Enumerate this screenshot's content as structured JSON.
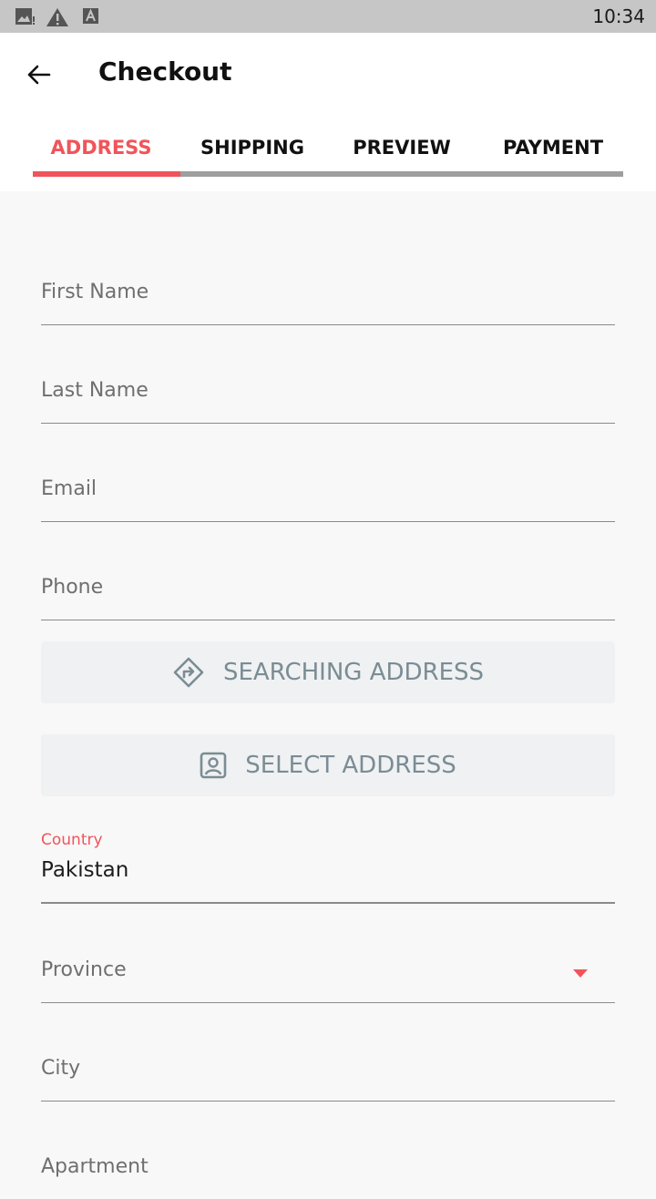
{
  "status_bar": {
    "time": "10:34",
    "icons": [
      "gallery-icon",
      "warning-icon",
      "font-icon"
    ]
  },
  "header": {
    "title": "Checkout",
    "back_icon": "back-arrow-icon"
  },
  "tabs": [
    {
      "label": "ADDRESS",
      "active": true
    },
    {
      "label": "SHIPPING",
      "active": false
    },
    {
      "label": "PREVIEW",
      "active": false
    },
    {
      "label": "PAYMENT",
      "active": false
    }
  ],
  "form": {
    "first_name": {
      "placeholder": "First Name",
      "value": ""
    },
    "last_name": {
      "placeholder": "Last Name",
      "value": ""
    },
    "email": {
      "placeholder": "Email",
      "value": ""
    },
    "phone": {
      "placeholder": "Phone",
      "value": ""
    },
    "searching_address_button": {
      "label": "SEARCHING ADDRESS",
      "icon": "directions-icon"
    },
    "select_address_button": {
      "label": "SELECT ADDRESS",
      "icon": "contact-card-icon"
    },
    "country": {
      "label": "Country",
      "value": "Pakistan"
    },
    "province": {
      "placeholder": "Province",
      "icon": "dropdown-arrow-icon"
    },
    "city": {
      "placeholder": "City",
      "value": ""
    },
    "apartment": {
      "placeholder": "Apartment",
      "value": ""
    }
  },
  "colors": {
    "accent": "#f0545a",
    "tab_track": "#9e9e9e",
    "button_bg": "#eff1f3",
    "button_text": "#7b8c94",
    "background": "#f8f8f8"
  }
}
